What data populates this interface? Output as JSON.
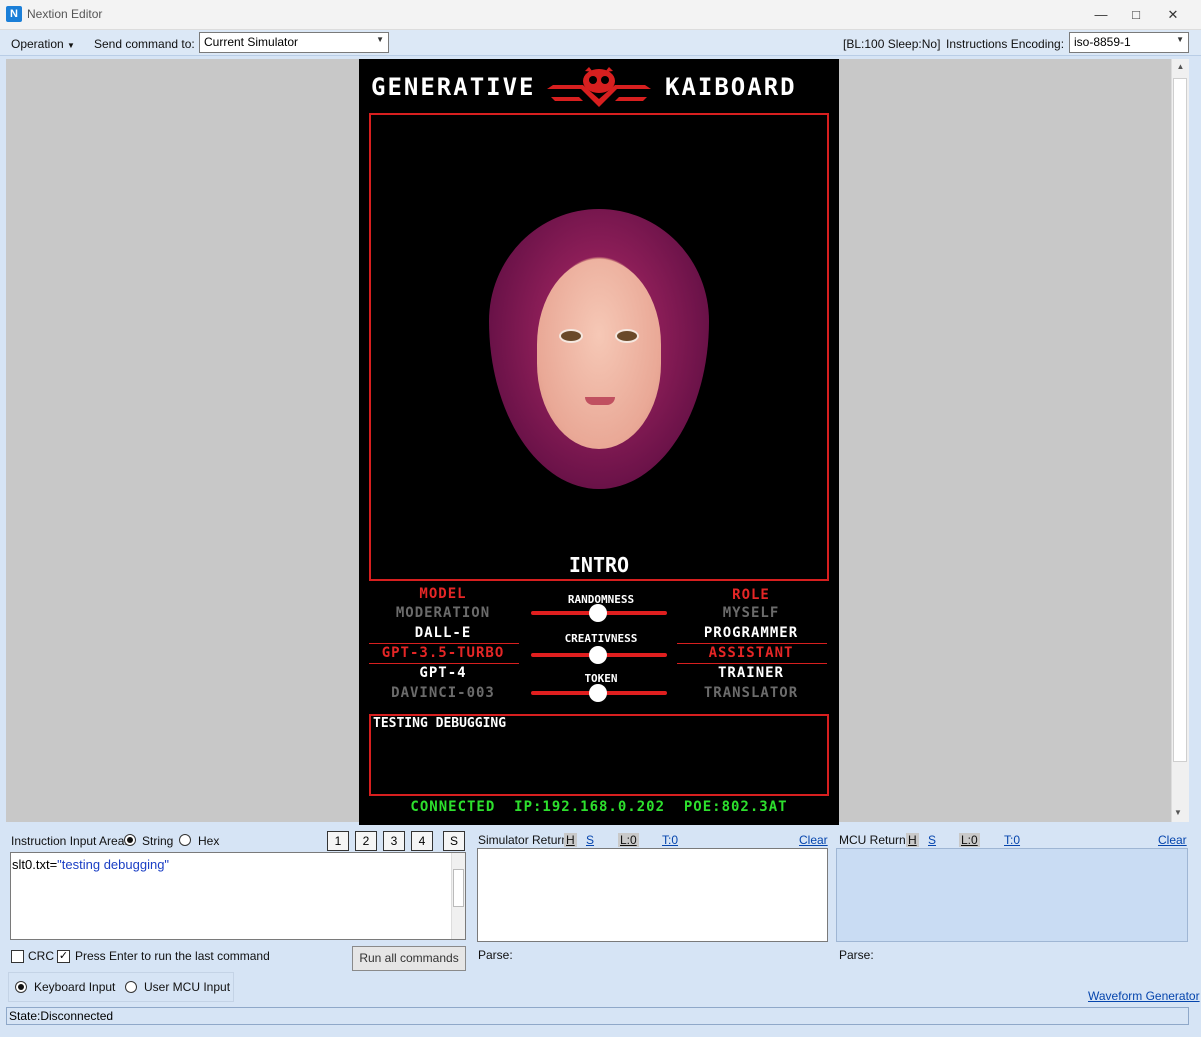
{
  "window": {
    "title": "Nextion Editor"
  },
  "toolbar": {
    "operation_label": "Operation",
    "send_label": "Send command to:",
    "send_target": "Current Simulator",
    "status_info": "[BL:100  Sleep:No]",
    "encoding_label": "Instructions Encoding:",
    "encoding_value": "iso-8859-1"
  },
  "hmi": {
    "title_left": "GENERATIVE",
    "title_right": "KAIBOARD",
    "frame_label": "INTRO",
    "model": {
      "header": "MODEL",
      "items": [
        "MODERATION",
        "DALL-E",
        "GPT-3.5-TURBO",
        "GPT-4",
        "DAVINCI-003"
      ]
    },
    "role": {
      "header": "ROLE",
      "items": [
        "MYSELF",
        "PROGRAMMER",
        "ASSISTANT",
        "TRAINER",
        "TRANSLATOR"
      ]
    },
    "sliders": {
      "randomness": "RANDOMNESS",
      "creativness": "CREATIVNESS",
      "token": "TOKEN"
    },
    "debug_text": "TESTING DEBUGGING",
    "status_line": "CONNECTED  IP:192.168.0.202  POE:802.3AT",
    "colors": {
      "accent": "#d71f1f",
      "connected": "#2de02d"
    }
  },
  "instruction": {
    "label": "Instruction Input Area:",
    "mode_string": "String",
    "mode_hex": "Hex",
    "buttons": [
      "1",
      "2",
      "3",
      "4",
      "S"
    ],
    "command_prefix": "slt0.txt=",
    "command_value": "\"testing debugging\"",
    "crc_label": "CRC",
    "enter_label": "Press Enter to run the last command",
    "run_all": "Run all commands",
    "keyboard_input": "Keyboard Input",
    "mcu_input": "User MCU Input"
  },
  "simulator_return": {
    "label": "Simulator Return:",
    "h": "H",
    "s": "S",
    "l": "L:0",
    "t": "T:0",
    "clear": "Clear",
    "parse": "Parse:"
  },
  "mcu_return": {
    "label": "MCU Return:",
    "h": "H",
    "s": "S",
    "l": "L:0",
    "t": "T:0",
    "clear": "Clear",
    "parse": "Parse:"
  },
  "waveform_link": "Waveform Generator",
  "status": "State:Disconnected"
}
